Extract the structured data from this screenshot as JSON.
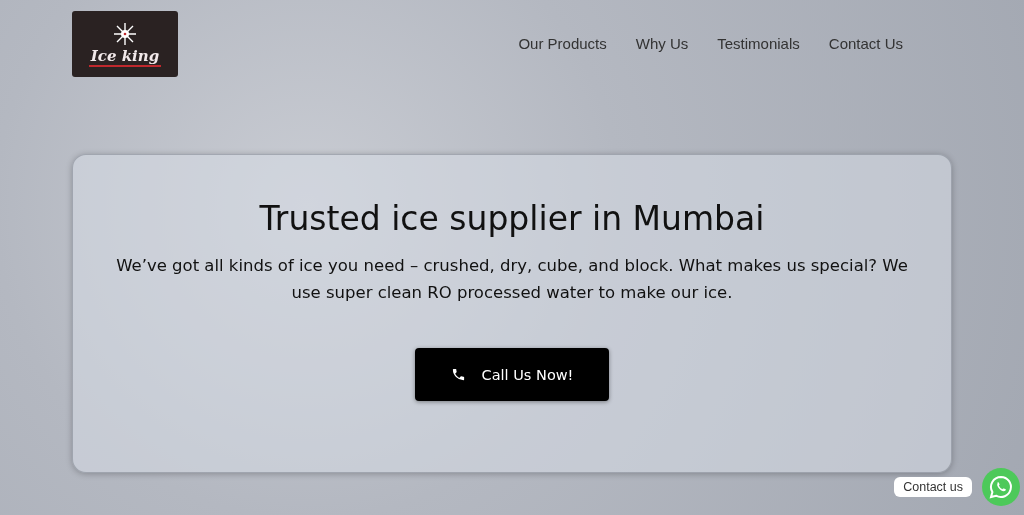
{
  "logo": {
    "text": "Ice king"
  },
  "nav": [
    {
      "label": "Our Products"
    },
    {
      "label": "Why Us"
    },
    {
      "label": "Testimonials"
    },
    {
      "label": "Contact Us"
    }
  ],
  "hero": {
    "title": "Trusted ice supplier in Mumbai",
    "description": "We’ve got all kinds of ice you need – crushed, dry, cube, and block. What makes us special? We use super clean RO processed water to make our ice.",
    "button": "Call Us Now!"
  },
  "chat_widget": {
    "label": "Contact us"
  }
}
